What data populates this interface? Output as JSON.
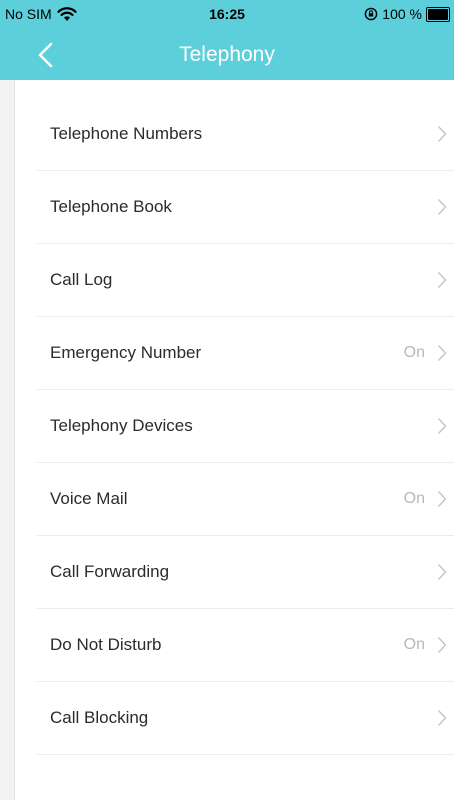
{
  "status_bar": {
    "carrier": "No SIM",
    "time": "16:25",
    "battery": "100 %",
    "wifi_icon": "wifi-icon",
    "orientation_lock_icon": "orientation-lock-icon",
    "battery_icon": "battery-icon"
  },
  "nav": {
    "title": "Telephony",
    "back_icon": "chevron-left-icon"
  },
  "colors": {
    "header": "#5ccfdb",
    "background": "#f3f3f3",
    "list_bg": "#ffffff",
    "label": "#2b2b2b",
    "value": "#b8b8b8",
    "chevron": "#c4c4c4"
  },
  "menu": {
    "items": [
      {
        "label": "Telephone Numbers",
        "value": ""
      },
      {
        "label": "Telephone Book",
        "value": ""
      },
      {
        "label": "Call Log",
        "value": ""
      },
      {
        "label": "Emergency Number",
        "value": "On"
      },
      {
        "label": "Telephony Devices",
        "value": ""
      },
      {
        "label": "Voice Mail",
        "value": "On"
      },
      {
        "label": "Call Forwarding",
        "value": ""
      },
      {
        "label": "Do Not Disturb",
        "value": "On"
      },
      {
        "label": "Call Blocking",
        "value": ""
      }
    ],
    "chevron_icon": "chevron-right-icon"
  }
}
